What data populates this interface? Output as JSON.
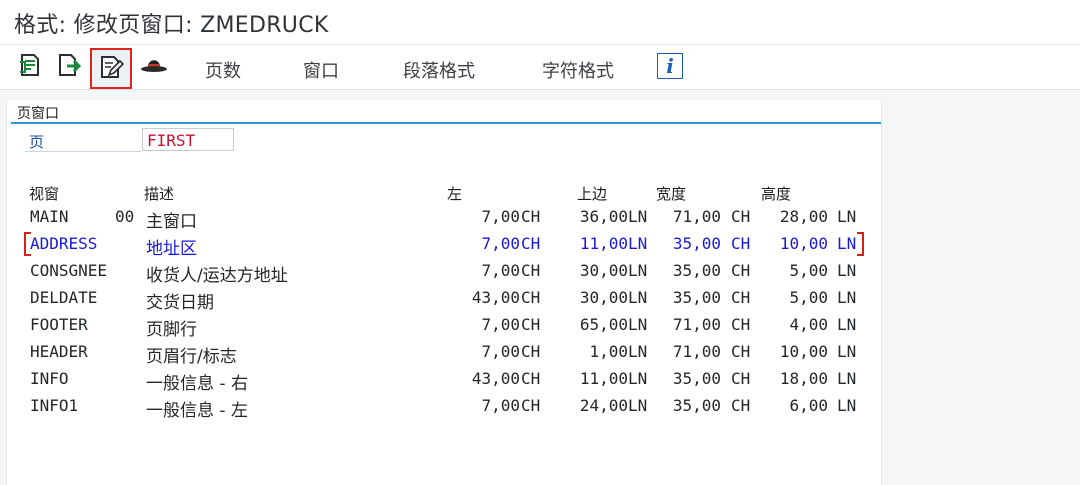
{
  "window": {
    "title": "格式: 修改页窗口: ZMEDRUCK"
  },
  "toolbar": {
    "menus": [
      "页数",
      "窗口",
      "段落格式",
      "字符格式"
    ],
    "icons": [
      "document-list-icon",
      "export-document-icon",
      "edit-document-icon",
      "hat-icon",
      "info-icon"
    ],
    "info_glyph": "i",
    "active_color": "#e0231c"
  },
  "group": {
    "title": "页窗口",
    "page_label": "页",
    "page_value": "FIRST"
  },
  "table": {
    "headers": {
      "window": "视窗",
      "desc": "描述",
      "left": "左",
      "top": "上边",
      "width": "宽度",
      "height": "高度"
    },
    "rows": [
      {
        "name": "MAIN",
        "code": "00",
        "desc": "主窗口",
        "left": "7,00",
        "left_unit": "CH",
        "top": "36,00",
        "top_unit": "LN",
        "width": "71,00",
        "width_unit": "CH",
        "height": "28,00",
        "height_unit": "LN"
      },
      {
        "name": "ADDRESS",
        "code": "",
        "desc": "地址区",
        "left": "7,00",
        "left_unit": "CH",
        "top": "11,00",
        "top_unit": "LN",
        "width": "35,00",
        "width_unit": "CH",
        "height": "10,00",
        "height_unit": "LN"
      },
      {
        "name": "CONSGNEE",
        "code": "",
        "desc": "收货人/运达方地址",
        "left": "7,00",
        "left_unit": "CH",
        "top": "30,00",
        "top_unit": "LN",
        "width": "35,00",
        "width_unit": "CH",
        "height": "5,00",
        "height_unit": "LN"
      },
      {
        "name": "DELDATE",
        "code": "",
        "desc": "交货日期",
        "left": "43,00",
        "left_unit": "CH",
        "top": "30,00",
        "top_unit": "LN",
        "width": "35,00",
        "width_unit": "CH",
        "height": "5,00",
        "height_unit": "LN"
      },
      {
        "name": "FOOTER",
        "code": "",
        "desc": "页脚行",
        "left": "7,00",
        "left_unit": "CH",
        "top": "65,00",
        "top_unit": "LN",
        "width": "71,00",
        "width_unit": "CH",
        "height": "4,00",
        "height_unit": "LN"
      },
      {
        "name": "HEADER",
        "code": "",
        "desc": "页眉行/标志",
        "left": "7,00",
        "left_unit": "CH",
        "top": "1,00",
        "top_unit": "LN",
        "width": "71,00",
        "width_unit": "CH",
        "height": "10,00",
        "height_unit": "LN"
      },
      {
        "name": "INFO",
        "code": "",
        "desc": "一般信息 - 右",
        "left": "43,00",
        "left_unit": "CH",
        "top": "11,00",
        "top_unit": "LN",
        "width": "35,00",
        "width_unit": "CH",
        "height": "18,00",
        "height_unit": "LN"
      },
      {
        "name": "INFO1",
        "code": "",
        "desc": "一般信息 - 左",
        "left": "7,00",
        "left_unit": "CH",
        "top": "24,00",
        "top_unit": "LN",
        "width": "35,00",
        "width_unit": "CH",
        "height": "6,00",
        "height_unit": "LN"
      }
    ],
    "selected_row": "ADDRESS",
    "selected_color": "#1818d8"
  }
}
